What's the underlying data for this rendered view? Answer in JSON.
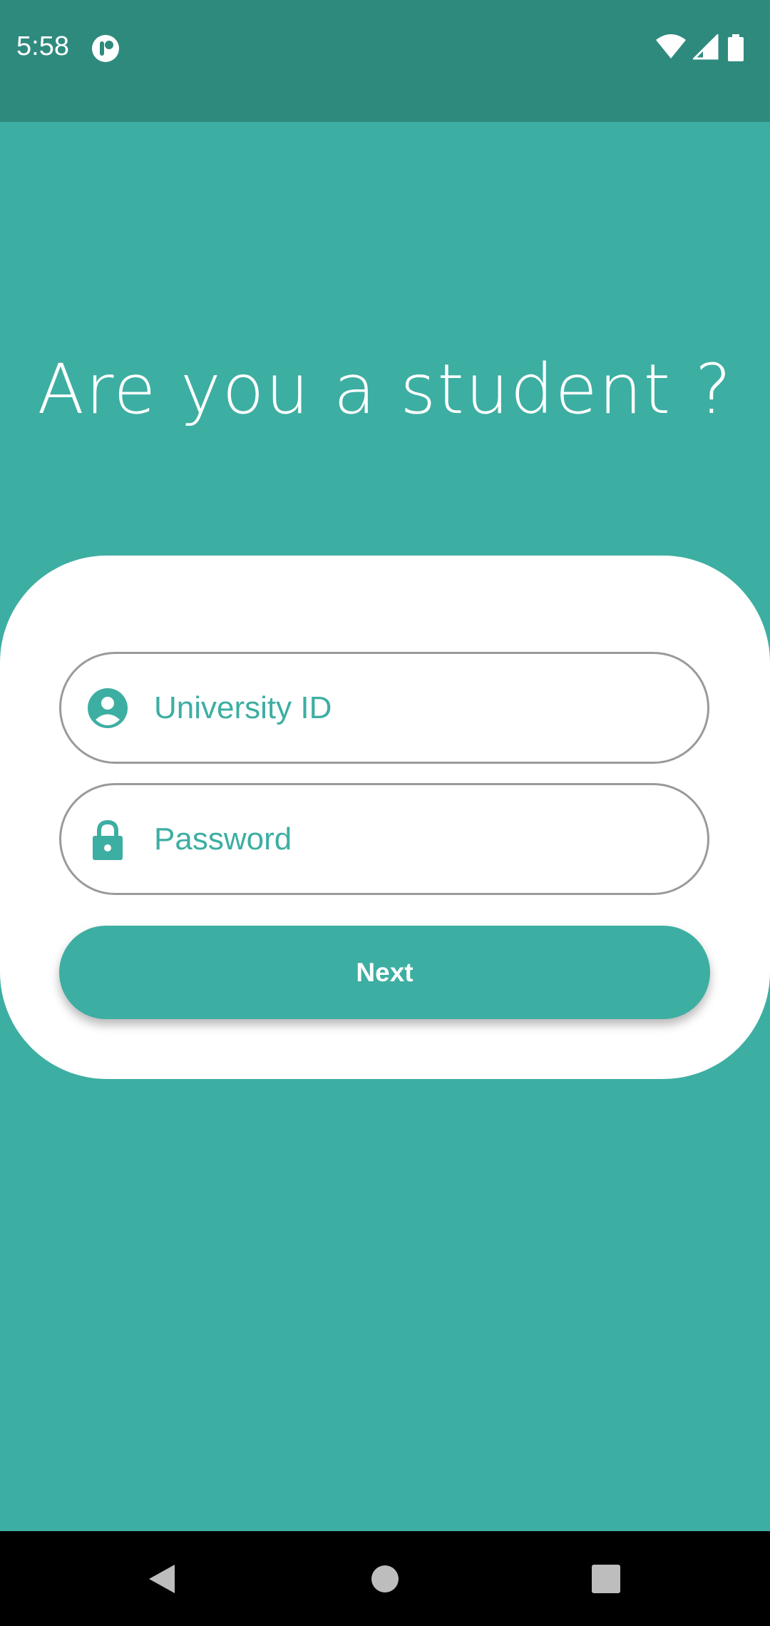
{
  "status_bar": {
    "time": "5:58"
  },
  "icons": {
    "app_notification": "app-notification-icon",
    "wifi": "wifi-icon",
    "signal": "cell-signal-icon",
    "battery": "battery-icon",
    "user": "account-circle-icon",
    "lock": "lock-icon",
    "back": "back-triangle-icon",
    "home": "home-circle-icon",
    "recents": "recents-square-icon"
  },
  "colors": {
    "primary": "#3daea2",
    "status_bar": "#2f8a7e",
    "card": "#ffffff",
    "field_border": "#9a9a9a",
    "nav_bar": "#000000"
  },
  "login": {
    "heading": "Are you a student ?",
    "university_id_placeholder": "University ID",
    "password_placeholder": "Password",
    "next_label": "Next"
  }
}
